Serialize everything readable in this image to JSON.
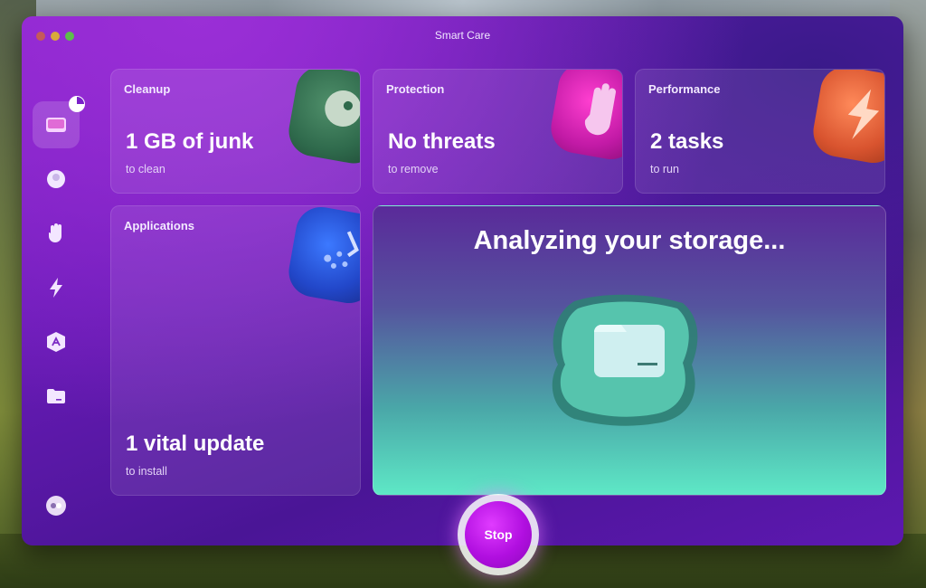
{
  "window": {
    "title": "Smart Care"
  },
  "sidebar": {
    "items": [
      {
        "icon": "cleanup-icon",
        "active": true
      },
      {
        "icon": "protection-disc-icon"
      },
      {
        "icon": "hand-icon"
      },
      {
        "icon": "bolt-icon"
      },
      {
        "icon": "apps-icon"
      },
      {
        "icon": "folder-icon"
      },
      {
        "icon": "assistant-icon"
      }
    ]
  },
  "cards": {
    "cleanup": {
      "label": "Cleanup",
      "value": "1 GB of junk",
      "sub": "to clean"
    },
    "protection": {
      "label": "Protection",
      "value": "No threats",
      "sub": "to remove"
    },
    "performance": {
      "label": "Performance",
      "value": "2 tasks",
      "sub": "to run"
    },
    "applications": {
      "label": "Applications",
      "value": "1 vital update",
      "sub": "to install"
    }
  },
  "analyzing": {
    "title": "Analyzing your storage..."
  },
  "stop_button": {
    "label": "Stop"
  },
  "colors": {
    "accent": "#b10fe0",
    "window_bg": "#6a1bb8",
    "analyze_bottom": "#5ee8c6"
  }
}
